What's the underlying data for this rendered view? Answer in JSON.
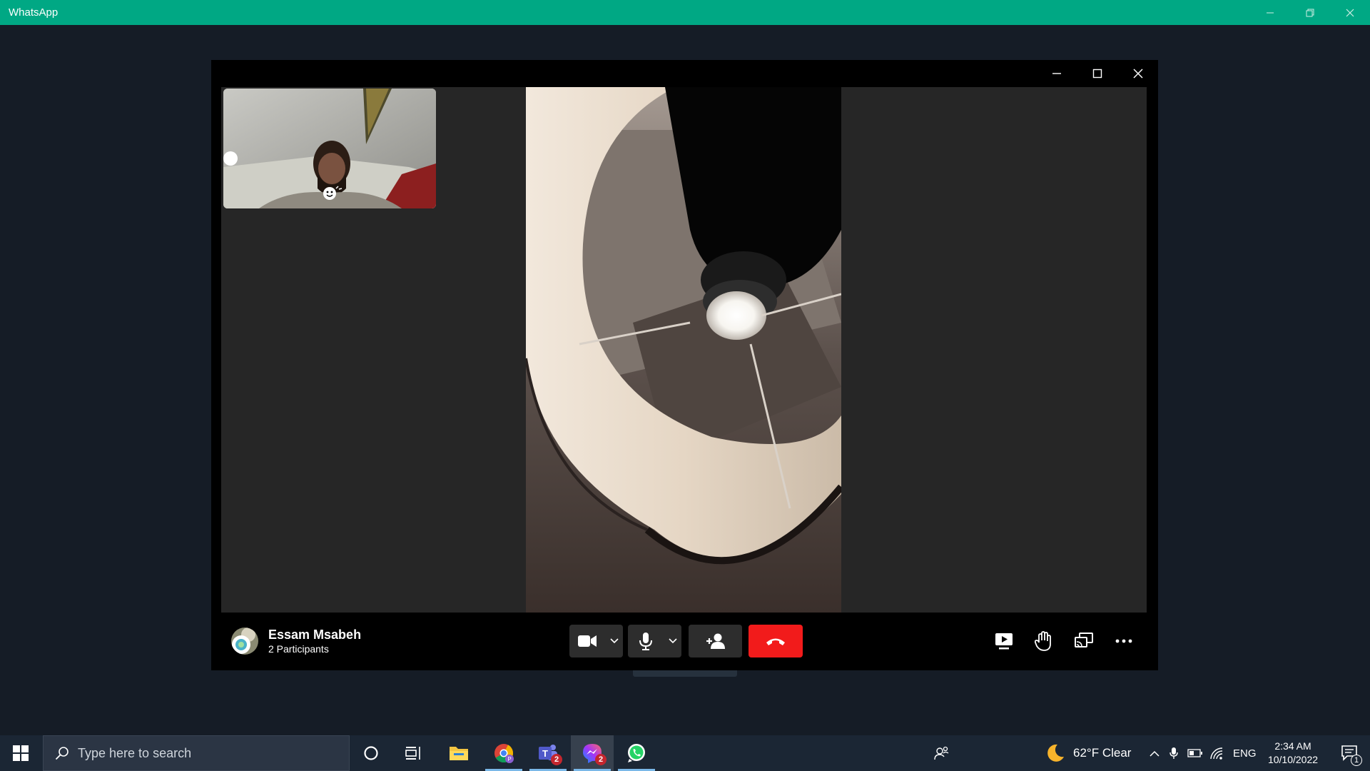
{
  "app": {
    "title": "WhatsApp"
  },
  "call": {
    "caller_name": "Essam Msabeh",
    "participants": "2 Participants",
    "controls": {
      "video": "video-camera-icon",
      "microphone": "microphone-icon",
      "add_participant": "add-person-icon",
      "end_call": "end-call-icon",
      "share_screen": "share-screen-icon",
      "raise_hand": "raise-hand-icon",
      "cast": "cast-icon",
      "more": "more-options-icon"
    },
    "colors": {
      "end_call": "#f21b1b",
      "accent": "#00a884"
    }
  },
  "taskbar": {
    "search_placeholder": "Type here to search",
    "apps": [
      {
        "name": "Cortana",
        "icon": "cortana-icon"
      },
      {
        "name": "Task View",
        "icon": "task-view-icon"
      },
      {
        "name": "File Explorer",
        "icon": "folder-icon"
      },
      {
        "name": "Chrome",
        "icon": "chrome-icon"
      },
      {
        "name": "Teams",
        "icon": "teams-icon",
        "badge": "2"
      },
      {
        "name": "Messenger",
        "icon": "messenger-icon",
        "badge": "2"
      },
      {
        "name": "WhatsApp",
        "icon": "whatsapp-icon"
      }
    ],
    "weather": "62°F  Clear",
    "language": "ENG",
    "time": "2:34 AM",
    "date": "10/10/2022",
    "notifications": "1"
  }
}
